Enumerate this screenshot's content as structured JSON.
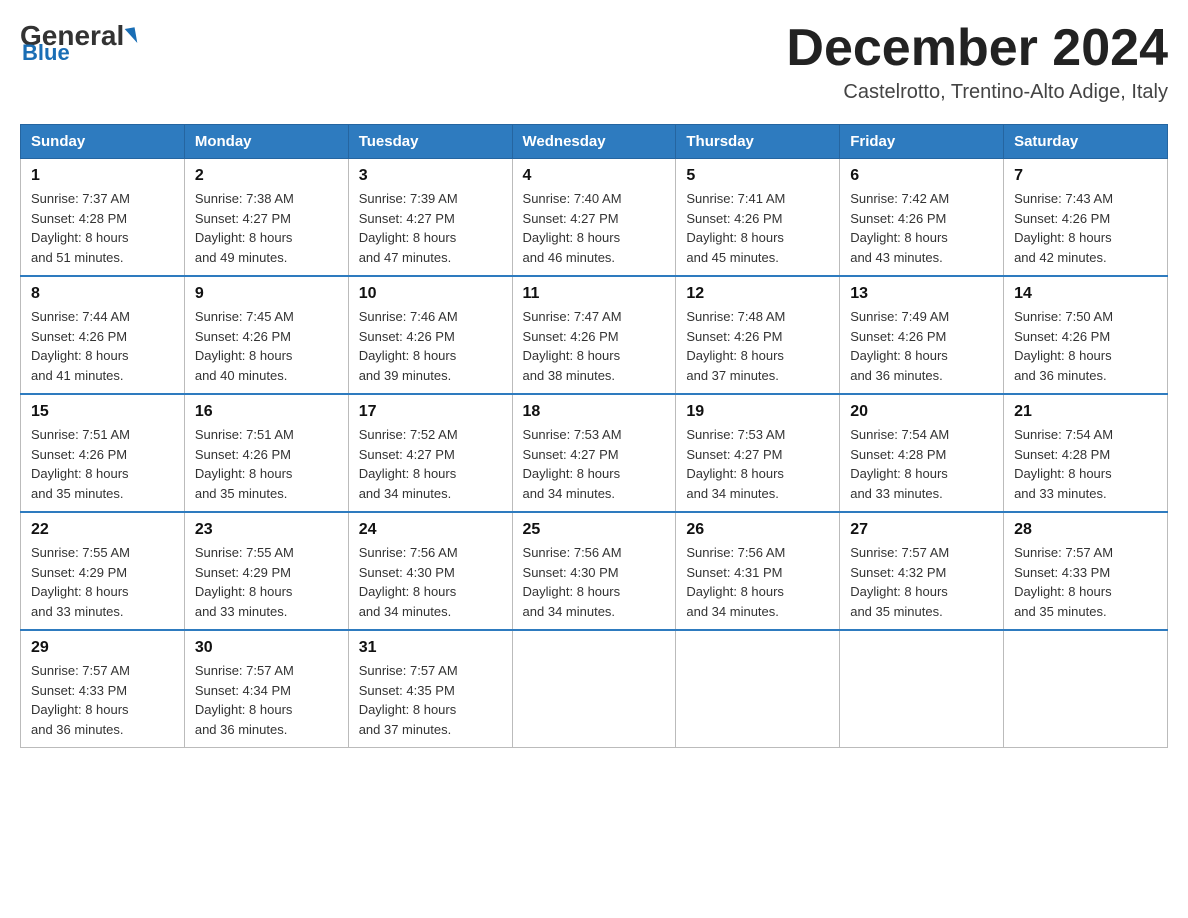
{
  "header": {
    "logo_general": "General",
    "logo_blue": "Blue",
    "month_title": "December 2024",
    "location": "Castelrotto, Trentino-Alto Adige, Italy"
  },
  "calendar": {
    "days_of_week": [
      "Sunday",
      "Monday",
      "Tuesday",
      "Wednesday",
      "Thursday",
      "Friday",
      "Saturday"
    ],
    "weeks": [
      [
        {
          "day": "1",
          "sunrise": "7:37 AM",
          "sunset": "4:28 PM",
          "daylight": "8 hours and 51 minutes."
        },
        {
          "day": "2",
          "sunrise": "7:38 AM",
          "sunset": "4:27 PM",
          "daylight": "8 hours and 49 minutes."
        },
        {
          "day": "3",
          "sunrise": "7:39 AM",
          "sunset": "4:27 PM",
          "daylight": "8 hours and 47 minutes."
        },
        {
          "day": "4",
          "sunrise": "7:40 AM",
          "sunset": "4:27 PM",
          "daylight": "8 hours and 46 minutes."
        },
        {
          "day": "5",
          "sunrise": "7:41 AM",
          "sunset": "4:26 PM",
          "daylight": "8 hours and 45 minutes."
        },
        {
          "day": "6",
          "sunrise": "7:42 AM",
          "sunset": "4:26 PM",
          "daylight": "8 hours and 43 minutes."
        },
        {
          "day": "7",
          "sunrise": "7:43 AM",
          "sunset": "4:26 PM",
          "daylight": "8 hours and 42 minutes."
        }
      ],
      [
        {
          "day": "8",
          "sunrise": "7:44 AM",
          "sunset": "4:26 PM",
          "daylight": "8 hours and 41 minutes."
        },
        {
          "day": "9",
          "sunrise": "7:45 AM",
          "sunset": "4:26 PM",
          "daylight": "8 hours and 40 minutes."
        },
        {
          "day": "10",
          "sunrise": "7:46 AM",
          "sunset": "4:26 PM",
          "daylight": "8 hours and 39 minutes."
        },
        {
          "day": "11",
          "sunrise": "7:47 AM",
          "sunset": "4:26 PM",
          "daylight": "8 hours and 38 minutes."
        },
        {
          "day": "12",
          "sunrise": "7:48 AM",
          "sunset": "4:26 PM",
          "daylight": "8 hours and 37 minutes."
        },
        {
          "day": "13",
          "sunrise": "7:49 AM",
          "sunset": "4:26 PM",
          "daylight": "8 hours and 36 minutes."
        },
        {
          "day": "14",
          "sunrise": "7:50 AM",
          "sunset": "4:26 PM",
          "daylight": "8 hours and 36 minutes."
        }
      ],
      [
        {
          "day": "15",
          "sunrise": "7:51 AM",
          "sunset": "4:26 PM",
          "daylight": "8 hours and 35 minutes."
        },
        {
          "day": "16",
          "sunrise": "7:51 AM",
          "sunset": "4:26 PM",
          "daylight": "8 hours and 35 minutes."
        },
        {
          "day": "17",
          "sunrise": "7:52 AM",
          "sunset": "4:27 PM",
          "daylight": "8 hours and 34 minutes."
        },
        {
          "day": "18",
          "sunrise": "7:53 AM",
          "sunset": "4:27 PM",
          "daylight": "8 hours and 34 minutes."
        },
        {
          "day": "19",
          "sunrise": "7:53 AM",
          "sunset": "4:27 PM",
          "daylight": "8 hours and 34 minutes."
        },
        {
          "day": "20",
          "sunrise": "7:54 AM",
          "sunset": "4:28 PM",
          "daylight": "8 hours and 33 minutes."
        },
        {
          "day": "21",
          "sunrise": "7:54 AM",
          "sunset": "4:28 PM",
          "daylight": "8 hours and 33 minutes."
        }
      ],
      [
        {
          "day": "22",
          "sunrise": "7:55 AM",
          "sunset": "4:29 PM",
          "daylight": "8 hours and 33 minutes."
        },
        {
          "day": "23",
          "sunrise": "7:55 AM",
          "sunset": "4:29 PM",
          "daylight": "8 hours and 33 minutes."
        },
        {
          "day": "24",
          "sunrise": "7:56 AM",
          "sunset": "4:30 PM",
          "daylight": "8 hours and 34 minutes."
        },
        {
          "day": "25",
          "sunrise": "7:56 AM",
          "sunset": "4:30 PM",
          "daylight": "8 hours and 34 minutes."
        },
        {
          "day": "26",
          "sunrise": "7:56 AM",
          "sunset": "4:31 PM",
          "daylight": "8 hours and 34 minutes."
        },
        {
          "day": "27",
          "sunrise": "7:57 AM",
          "sunset": "4:32 PM",
          "daylight": "8 hours and 35 minutes."
        },
        {
          "day": "28",
          "sunrise": "7:57 AM",
          "sunset": "4:33 PM",
          "daylight": "8 hours and 35 minutes."
        }
      ],
      [
        {
          "day": "29",
          "sunrise": "7:57 AM",
          "sunset": "4:33 PM",
          "daylight": "8 hours and 36 minutes."
        },
        {
          "day": "30",
          "sunrise": "7:57 AM",
          "sunset": "4:34 PM",
          "daylight": "8 hours and 36 minutes."
        },
        {
          "day": "31",
          "sunrise": "7:57 AM",
          "sunset": "4:35 PM",
          "daylight": "8 hours and 37 minutes."
        },
        {
          "day": "",
          "sunrise": "",
          "sunset": "",
          "daylight": ""
        },
        {
          "day": "",
          "sunrise": "",
          "sunset": "",
          "daylight": ""
        },
        {
          "day": "",
          "sunrise": "",
          "sunset": "",
          "daylight": ""
        },
        {
          "day": "",
          "sunrise": "",
          "sunset": "",
          "daylight": ""
        }
      ]
    ],
    "labels": {
      "sunrise": "Sunrise: ",
      "sunset": "Sunset: ",
      "daylight": "Daylight: "
    }
  }
}
